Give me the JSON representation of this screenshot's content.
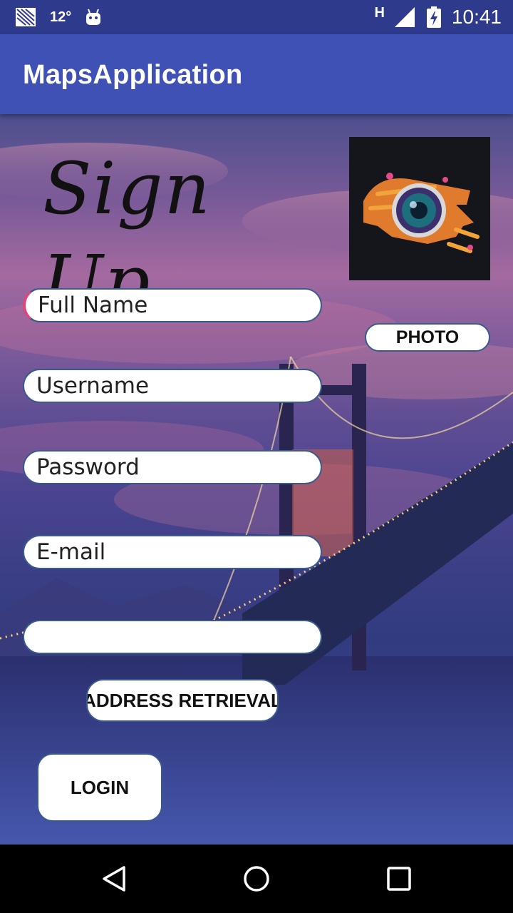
{
  "status_bar": {
    "temperature": "12°",
    "network_type": "H",
    "time": "10:41",
    "icons": [
      "image-icon",
      "android-icon",
      "signal-icon",
      "battery-charging-icon"
    ]
  },
  "app_bar": {
    "title": "MapsApplication"
  },
  "header": {
    "signup_title": "Sign Up"
  },
  "form": {
    "full_name_placeholder": "Full Name",
    "username_placeholder": "Username",
    "password_placeholder": "Password",
    "email_placeholder": "E-mail",
    "address_value": ""
  },
  "buttons": {
    "photo": "PHOTO",
    "address_retrieval": "ADDRESS RETRIEVAL",
    "login": "LOGIN"
  },
  "nav_bar": {
    "icons": [
      "back-icon",
      "home-icon",
      "recents-icon"
    ]
  },
  "colors": {
    "status_bar": "#2e3a8c",
    "app_bar": "#3f51b5",
    "field_border": "#3a5a8c",
    "focus_accent": "#e0457a"
  }
}
